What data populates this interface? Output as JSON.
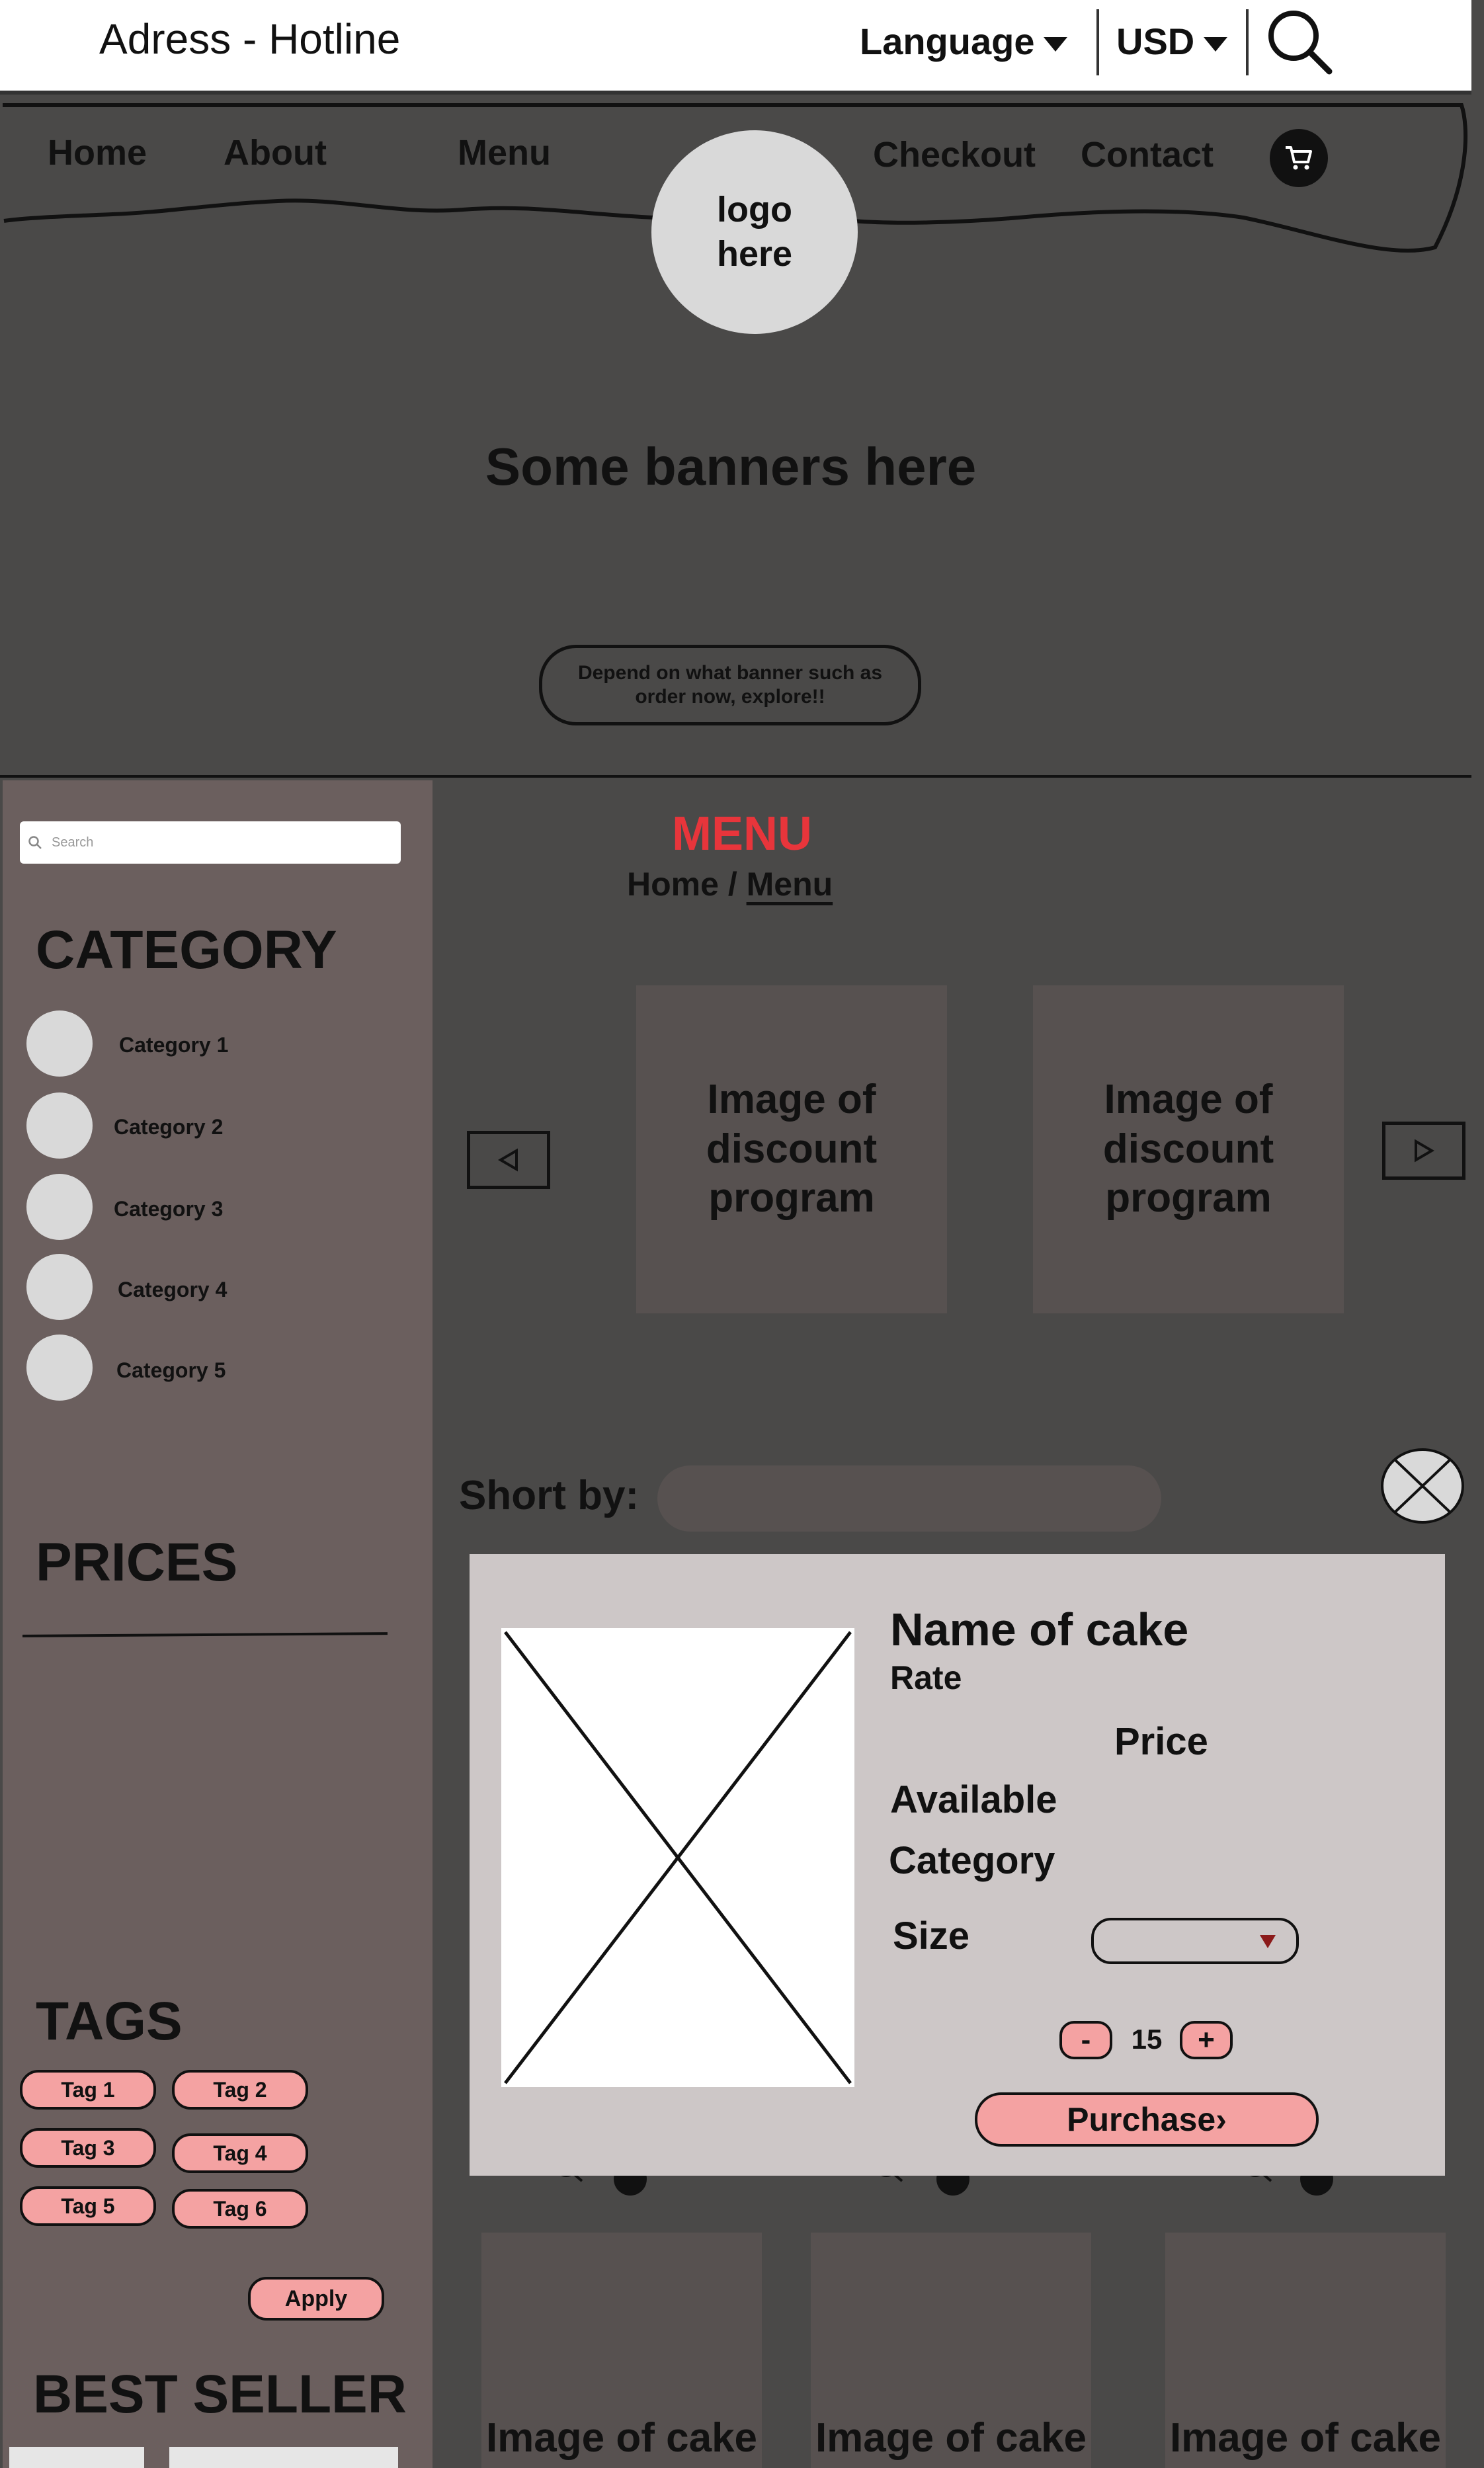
{
  "header": {
    "address": "Adress - Hotline",
    "language": "Language",
    "currency": "USD",
    "icons": [
      "search-icon",
      "chevron-down-icon"
    ]
  },
  "nav": {
    "items": [
      "Home",
      "About",
      "Menu",
      "Checkout",
      "Contact"
    ],
    "logo": "logo\nhere",
    "cart_icon": "cart-icon"
  },
  "hero": {
    "banner": "Some banners here",
    "cta": "Depend on what banner such as order now, explore!!"
  },
  "sidebar": {
    "search_placeholder": "Search",
    "category_title": "CATEGORY",
    "categories": [
      "Category 1",
      "Category 2",
      "Category 3",
      "Category 4",
      "Category 5"
    ],
    "prices_title": "PRICES",
    "tags_title": "TAGS",
    "tags": [
      "Tag 1",
      "Tag 2",
      "Tag 3",
      "Tag 4",
      "Tag 5",
      "Tag 6"
    ],
    "apply": "Apply",
    "bestseller_title": "BEST SELLER"
  },
  "main": {
    "title": "MENU",
    "breadcrumb": {
      "home": "Home",
      "sep": " / ",
      "current": "Menu"
    },
    "promos": [
      "Image of discount program",
      "Image of discount program"
    ],
    "sort_label": "Short by:",
    "products": [
      "Image of cake",
      "Image of cake",
      "Image of cake"
    ]
  },
  "modal": {
    "name": "Name of cake",
    "rate": "Rate",
    "price": "Price",
    "available": "Available",
    "category": "Category",
    "size": "Size",
    "minus": "-",
    "plus": "+",
    "quantity": "15",
    "purchase": "Purchase›"
  },
  "colors": {
    "page_bg": "#4a4948",
    "sidebar_bg": "#6b5f5e",
    "accent_pink": "#f4a2a2",
    "menu_red": "#e8353b",
    "modal_bg": "#cdc7c7"
  }
}
